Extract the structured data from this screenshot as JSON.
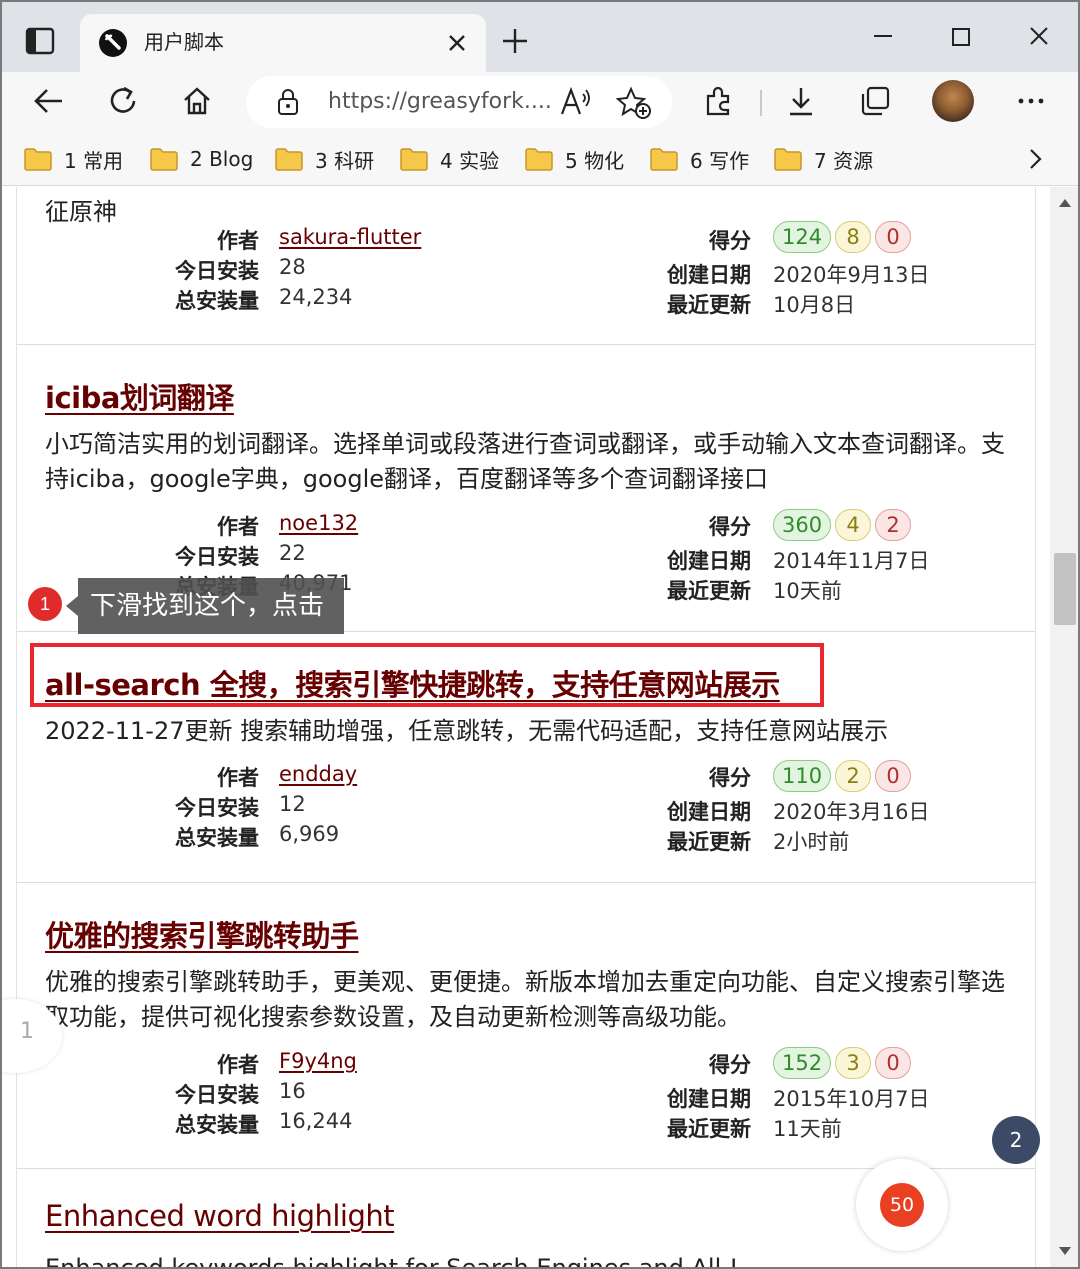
{
  "browser": {
    "tab_title": "用户脚本",
    "url": "https://greasyfork....",
    "bookmarks": [
      "1 常用",
      "2 Blog",
      "3 科研",
      "4 实验",
      "5 物化",
      "6 写作",
      "7 资源"
    ]
  },
  "labels": {
    "author": "作者",
    "daily_installs": "今日安装",
    "total_installs": "总安装量",
    "rating": "得分",
    "created": "创建日期",
    "updated": "最近更新"
  },
  "partial_top_text": "征原神",
  "scripts": [
    {
      "title": "",
      "description": "",
      "author": "sakura-flutter",
      "daily_installs": "28",
      "total_installs": "24,234",
      "rating_good": "124",
      "rating_ok": "8",
      "rating_bad": "0",
      "created": "2020年9月13日",
      "updated": "10月8日"
    },
    {
      "title": "iciba划词翻译",
      "description": "小巧简洁实用的划词翻译。选择单词或段落进行查词或翻译，或手动输入文本查词翻译。支持iciba，google字典，google翻译，百度翻译等多个查词翻译接口",
      "author": "noe132",
      "daily_installs": "22",
      "total_installs": "40,971",
      "rating_good": "360",
      "rating_ok": "4",
      "rating_bad": "2",
      "created": "2014年11月7日",
      "updated": "10天前"
    },
    {
      "title": "all-search 全搜，搜索引擎快捷跳转，支持任意网站展示",
      "description": "2022-11-27更新 搜索辅助增强，任意跳转，无需代码适配，支持任意网站展示",
      "author": "endday",
      "daily_installs": "12",
      "total_installs": "6,969",
      "rating_good": "110",
      "rating_ok": "2",
      "rating_bad": "0",
      "created": "2020年3月16日",
      "updated": "2小时前"
    },
    {
      "title": "优雅的搜索引擎跳转助手",
      "description": "优雅的搜索引擎跳转助手，更美观、更便捷。新版本增加去重定向功能、自定义搜索引擎选取功能，提供可视化搜索参数设置，及自动更新检测等高级功能。",
      "author": "F9y4ng",
      "daily_installs": "16",
      "total_installs": "16,244",
      "rating_good": "152",
      "rating_ok": "3",
      "rating_bad": "0",
      "created": "2015年10月7日",
      "updated": "11天前"
    },
    {
      "title": "Enhanced word highlight",
      "description": "Enhanced keywords highlight for Search Engines and All !"
    }
  ],
  "annotations": {
    "step1_number": "1",
    "step1_text": "下滑找到这个，点击",
    "step2_number": "2",
    "floating_badge": "50",
    "side_bubble_number": "1"
  }
}
